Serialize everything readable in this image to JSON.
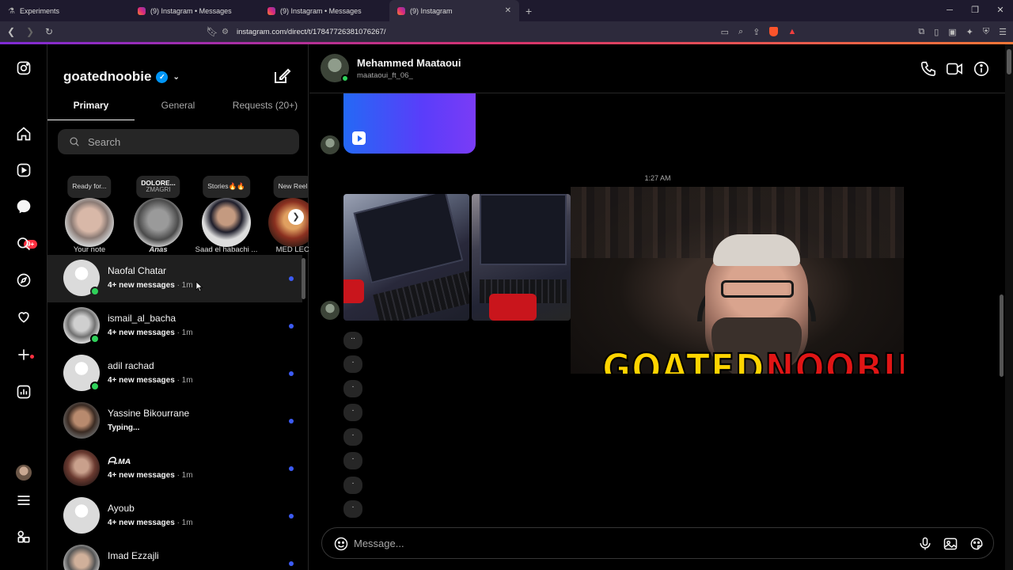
{
  "browser": {
    "tabs": [
      {
        "title": "Experiments"
      },
      {
        "title": "(9) Instagram • Messages"
      },
      {
        "title": "(9) Instagram • Messages"
      },
      {
        "title": "(9) Instagram"
      }
    ],
    "url": "instagram.com/direct/t/17847726381076267/"
  },
  "sidebar": {
    "notification_badge": "9+"
  },
  "inbox": {
    "account": "goatednoobie",
    "tabs": [
      "Primary",
      "General",
      "Requests (20+)"
    ],
    "search_placeholder": "Search",
    "notes": [
      {
        "bubble": "Ready for...",
        "bubble_sub": "",
        "name": "Your note"
      },
      {
        "bubble": "DOLORE...",
        "bubble_sub": "ZMAGRI",
        "name": "Anas"
      },
      {
        "bubble": "Stories🔥🔥",
        "bubble_sub": "",
        "name": "Saad el habachi ..."
      },
      {
        "bubble": "New Reel",
        "bubble_sub": "",
        "name": "MED LEO"
      }
    ],
    "threads": [
      {
        "name": "Naofal Chatar",
        "status": "4+ new messages",
        "time": "· 1m"
      },
      {
        "name": "ismail_al_bacha",
        "status": "4+ new messages",
        "time": "· 1m"
      },
      {
        "name": "adil rachad",
        "status": "4+ new messages",
        "time": "· 1m"
      },
      {
        "name": "Yassine Bikourrane",
        "status": "Typing...",
        "time": ""
      },
      {
        "name": "ᗩ.ᴍᴀ",
        "status": "4+ new messages",
        "time": "· 1m"
      },
      {
        "name": "Ayoub",
        "status": "4+ new messages",
        "time": "· 1m"
      },
      {
        "name": "Imad Ezzajli",
        "status": "",
        "time": ""
      }
    ]
  },
  "chat": {
    "name": "Mehammed Maataoui",
    "username": "maataoui_ft_06_",
    "timestamp": "1:27 AM",
    "dots": [
      "..",
      ".",
      ".",
      ".",
      ".",
      ".",
      ".",
      "."
    ],
    "overlay_logo_left": "GOATED",
    "overlay_logo_right": "NOOBIE",
    "composer_placeholder": "Message..."
  },
  "colors": {
    "accent_unread": "#3c5bf4",
    "online": "#2fd15a",
    "badge": "#ff3040",
    "verified": "#0095f6"
  }
}
